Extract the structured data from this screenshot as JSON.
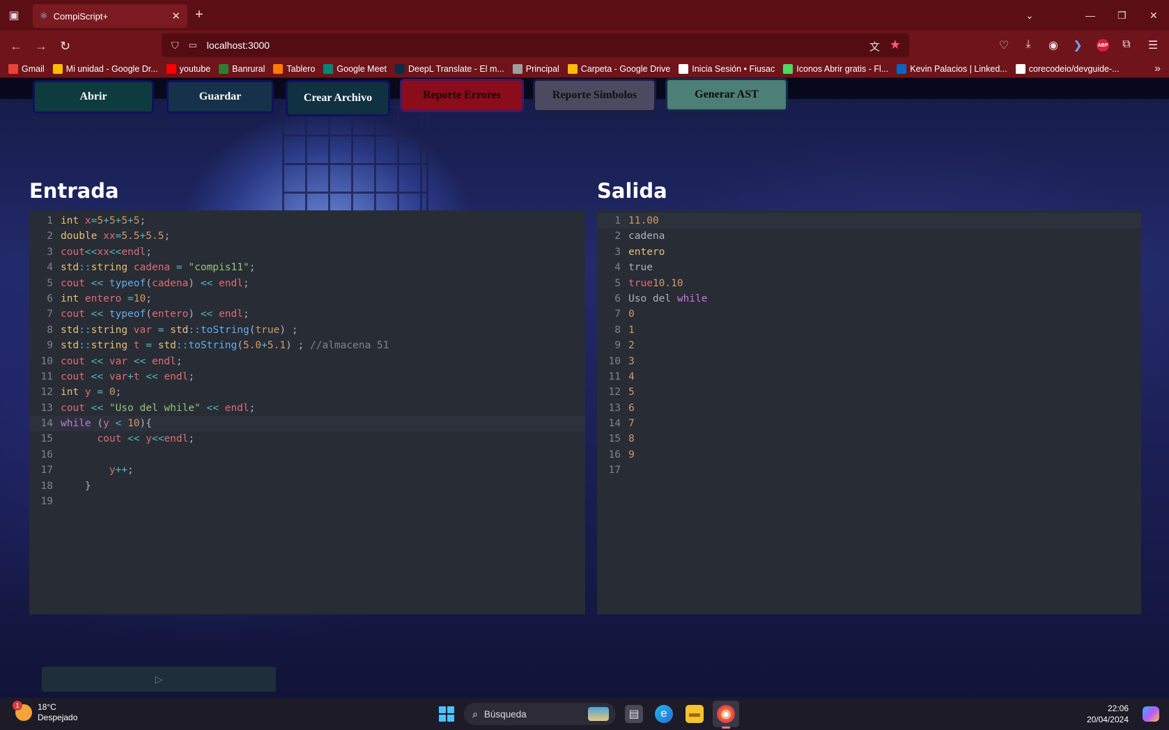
{
  "browser": {
    "tab_title": "CompiScript+",
    "url": "localhost:3000",
    "bookmarks": [
      {
        "label": "Gmail",
        "icon": "gmail-icon",
        "color": "#ea4335"
      },
      {
        "label": "Mi unidad - Google Dr...",
        "icon": "drive-icon",
        "color": "#fbbc04"
      },
      {
        "label": "youtube",
        "icon": "youtube-icon",
        "color": "#ff0000"
      },
      {
        "label": "Banrural",
        "icon": "banrural-icon",
        "color": "#2e7d32"
      },
      {
        "label": "Tablero",
        "icon": "tablero-icon",
        "color": "#ff7a00"
      },
      {
        "label": "Google Meet",
        "icon": "meet-icon",
        "color": "#00897b"
      },
      {
        "label": "DeepL Translate - El m...",
        "icon": "deepl-icon",
        "color": "#0f2b46"
      },
      {
        "label": "Principal",
        "icon": "principal-icon",
        "color": "#9e9e9e"
      },
      {
        "label": "Carpeta - Google Drive",
        "icon": "drive-icon",
        "color": "#fbbc04"
      },
      {
        "label": "Inicia Sesión • Fiusac",
        "icon": "fiusac-icon",
        "color": "#ffffff"
      },
      {
        "label": "Iconos Abrir gratis - Fl...",
        "icon": "flaticon-icon",
        "color": "#4cd964"
      },
      {
        "label": "Kevin Palacios | Linked...",
        "icon": "linkedin-icon",
        "color": "#0a66c2"
      },
      {
        "label": "corecodeio/devguide-...",
        "icon": "github-icon",
        "color": "#ffffff"
      }
    ]
  },
  "toolbar": {
    "abrir": "Abrir",
    "guardar": "Guardar",
    "crear": "Crear Archivo",
    "errores": "Reporte Errores",
    "simbolos": "Reporte Simbolos",
    "ast": "Generar AST"
  },
  "entrada": {
    "title": "Entrada",
    "lines": [
      [
        [
          "kw",
          "int "
        ],
        [
          "var",
          "x"
        ],
        [
          "op",
          "="
        ],
        [
          "num",
          "5"
        ],
        [
          "op",
          "+"
        ],
        [
          "num",
          "5"
        ],
        [
          "op",
          "+"
        ],
        [
          "num",
          "5"
        ],
        [
          "op",
          "+"
        ],
        [
          "num",
          "5"
        ],
        [
          "",
          "; "
        ]
      ],
      [
        [
          "kw",
          "double "
        ],
        [
          "var",
          "xx"
        ],
        [
          "op",
          "="
        ],
        [
          "num",
          "5.5"
        ],
        [
          "op",
          "+"
        ],
        [
          "num",
          "5.5"
        ],
        [
          "",
          ";"
        ]
      ],
      [
        [
          "var",
          "cout"
        ],
        [
          "op",
          "<<"
        ],
        [
          "var",
          "xx"
        ],
        [
          "op",
          "<<"
        ],
        [
          "var",
          "endl"
        ],
        [
          "",
          ";"
        ]
      ],
      [
        [
          "kw",
          "std"
        ],
        [
          "op",
          "::"
        ],
        [
          "kw",
          "string "
        ],
        [
          "var",
          "cadena"
        ],
        [
          "op",
          " = "
        ],
        [
          "str",
          "\"compis11\""
        ],
        [
          "",
          ";"
        ]
      ],
      [
        [
          "var",
          "cout"
        ],
        [
          "op",
          " << "
        ],
        [
          "fn",
          "typeof"
        ],
        [
          "",
          "("
        ],
        [
          "var",
          "cadena"
        ],
        [
          "",
          ")"
        ],
        [
          "op",
          " << "
        ],
        [
          "var",
          "endl"
        ],
        [
          "",
          ";"
        ]
      ],
      [
        [
          "kw",
          "int "
        ],
        [
          "var",
          "entero"
        ],
        [
          "op",
          " ="
        ],
        [
          "num",
          "10"
        ],
        [
          "",
          ";"
        ]
      ],
      [
        [
          "var",
          "cout"
        ],
        [
          "op",
          " << "
        ],
        [
          "fn",
          "typeof"
        ],
        [
          "",
          "("
        ],
        [
          "var",
          "entero"
        ],
        [
          "",
          ")"
        ],
        [
          "op",
          " << "
        ],
        [
          "var",
          "endl"
        ],
        [
          "",
          ";"
        ]
      ],
      [
        [
          "kw",
          "std"
        ],
        [
          "op",
          "::"
        ],
        [
          "kw",
          "string "
        ],
        [
          "var",
          "var"
        ],
        [
          "op",
          " = "
        ],
        [
          "kw",
          "std"
        ],
        [
          "op",
          "::"
        ],
        [
          "fn",
          "toString"
        ],
        [
          "",
          "("
        ],
        [
          "num",
          "true"
        ],
        [
          "",
          ") ;"
        ]
      ],
      [
        [
          "kw",
          "std"
        ],
        [
          "op",
          "::"
        ],
        [
          "kw",
          "string "
        ],
        [
          "var",
          "t"
        ],
        [
          "op",
          " = "
        ],
        [
          "kw",
          "std"
        ],
        [
          "op",
          "::"
        ],
        [
          "fn",
          "toString"
        ],
        [
          "",
          "("
        ],
        [
          "num",
          "5.0"
        ],
        [
          "op",
          "+"
        ],
        [
          "num",
          "5.1"
        ],
        [
          "",
          ") ; "
        ],
        [
          "cm",
          "//almacena 51"
        ]
      ],
      [
        [
          "var",
          "cout"
        ],
        [
          "op",
          " << "
        ],
        [
          "var",
          "var"
        ],
        [
          "op",
          " << "
        ],
        [
          "var",
          "endl"
        ],
        [
          "",
          ";"
        ]
      ],
      [
        [
          "var",
          "cout"
        ],
        [
          "op",
          " << "
        ],
        [
          "var",
          "var"
        ],
        [
          "op",
          "+"
        ],
        [
          "var",
          "t"
        ],
        [
          "op",
          " << "
        ],
        [
          "var",
          "endl"
        ],
        [
          "",
          ";"
        ]
      ],
      [
        [
          "kw",
          "int "
        ],
        [
          "var",
          "y"
        ],
        [
          "op",
          " = "
        ],
        [
          "num",
          "0"
        ],
        [
          "",
          ";"
        ]
      ],
      [
        [
          "var",
          "cout"
        ],
        [
          "op",
          " << "
        ],
        [
          "str",
          "\"Uso del while\""
        ],
        [
          "op",
          " << "
        ],
        [
          "var",
          "endl"
        ],
        [
          "",
          ";"
        ]
      ],
      [
        [
          "kw2",
          "while "
        ],
        [
          "",
          "("
        ],
        [
          "var",
          "y"
        ],
        [
          "op",
          " < "
        ],
        [
          "num",
          "10"
        ],
        [
          "",
          "){"
        ]
      ],
      [
        [
          "",
          "      "
        ],
        [
          "var",
          "cout"
        ],
        [
          "op",
          " << "
        ],
        [
          "var",
          "y"
        ],
        [
          "op",
          "<<"
        ],
        [
          "var",
          "endl"
        ],
        [
          "",
          ";"
        ]
      ],
      [
        [
          "",
          ""
        ]
      ],
      [
        [
          "",
          "        "
        ],
        [
          "var",
          "y"
        ],
        [
          "op",
          "++"
        ],
        [
          "",
          ";"
        ]
      ],
      [
        [
          "",
          "    }"
        ]
      ],
      [
        [
          "",
          ""
        ]
      ]
    ]
  },
  "salida": {
    "title": "Salida",
    "lines": [
      [
        [
          "num",
          "11.00"
        ]
      ],
      [
        [
          "",
          "cadena"
        ]
      ],
      [
        [
          "kw",
          "entero"
        ]
      ],
      [
        [
          "",
          "true"
        ]
      ],
      [
        [
          "var",
          "true"
        ],
        [
          "num",
          "10.10"
        ]
      ],
      [
        [
          "",
          "Uso del "
        ],
        [
          "kw2",
          "while"
        ]
      ],
      [
        [
          "num",
          "0"
        ]
      ],
      [
        [
          "num",
          "1"
        ]
      ],
      [
        [
          "num",
          "2"
        ]
      ],
      [
        [
          "num",
          "3"
        ]
      ],
      [
        [
          "num",
          "4"
        ]
      ],
      [
        [
          "num",
          "5"
        ]
      ],
      [
        [
          "num",
          "6"
        ]
      ],
      [
        [
          "num",
          "7"
        ]
      ],
      [
        [
          "num",
          "8"
        ]
      ],
      [
        [
          "num",
          "9"
        ]
      ],
      [
        [
          "",
          ""
        ]
      ]
    ]
  },
  "taskbar": {
    "temp": "18°C",
    "weather": "Despejado",
    "weather_badge": "1",
    "search": "Búsqueda",
    "time": "22:06",
    "date": "20/04/2024"
  }
}
